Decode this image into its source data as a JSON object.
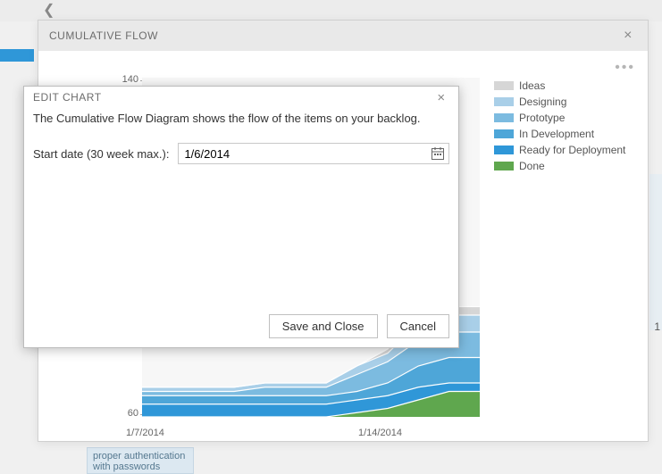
{
  "bg": {
    "right_number": "1",
    "note_line1": "proper authentication",
    "note_line2": "with passwords"
  },
  "panel": {
    "title": "CUMULATIVE FLOW"
  },
  "legend": {
    "items": [
      {
        "label": "Ideas",
        "color": "#d6d6d6"
      },
      {
        "label": "Designing",
        "color": "#a9cfe8"
      },
      {
        "label": "Prototype",
        "color": "#7cbbe0"
      },
      {
        "label": "In Development",
        "color": "#4ea6d8"
      },
      {
        "label": "Ready for Deployment",
        "color": "#2f97d8"
      },
      {
        "label": "Done",
        "color": "#5fa74e"
      }
    ]
  },
  "modal": {
    "title": "EDIT CHART",
    "description": "The Cumulative Flow Diagram shows the flow of the items on your backlog.",
    "start_date_label": "Start date (30 week max.):",
    "start_date_value": "1/6/2014",
    "save_label": "Save and Close",
    "cancel_label": "Cancel"
  },
  "chart_data": {
    "type": "area",
    "xlabel": "",
    "ylabel": "",
    "ylim": [
      60,
      140
    ],
    "x_tick_labels": [
      "1/7/2014",
      "1/14/2014"
    ],
    "x": [
      0,
      1,
      2,
      3,
      4,
      5,
      6,
      7,
      8,
      9,
      10,
      11
    ],
    "series": [
      {
        "name": "Done",
        "color": "#5fa74e",
        "values": [
          60,
          60,
          60,
          60,
          60,
          60,
          60,
          61,
          62,
          64,
          66,
          66
        ]
      },
      {
        "name": "Ready for Deployment",
        "color": "#2f97d8",
        "values": [
          63,
          63,
          63,
          63,
          63,
          63,
          63,
          64,
          65,
          67,
          68,
          68
        ]
      },
      {
        "name": "In Development",
        "color": "#4ea6d8",
        "values": [
          65,
          65,
          65,
          65,
          65,
          65,
          65,
          66,
          68,
          72,
          74,
          74
        ]
      },
      {
        "name": "Prototype",
        "color": "#7cbbe0",
        "values": [
          66,
          66,
          66,
          66,
          67,
          67,
          67,
          70,
          73,
          78,
          80,
          80
        ]
      },
      {
        "name": "Designing",
        "color": "#a9cfe8",
        "values": [
          67,
          67,
          67,
          67,
          68,
          68,
          68,
          72,
          75,
          82,
          84,
          84
        ]
      },
      {
        "name": "Ideas",
        "color": "#d6d6d6",
        "values": [
          67,
          67,
          67,
          67,
          68,
          68,
          68,
          72,
          76,
          83,
          86,
          86
        ]
      }
    ]
  }
}
